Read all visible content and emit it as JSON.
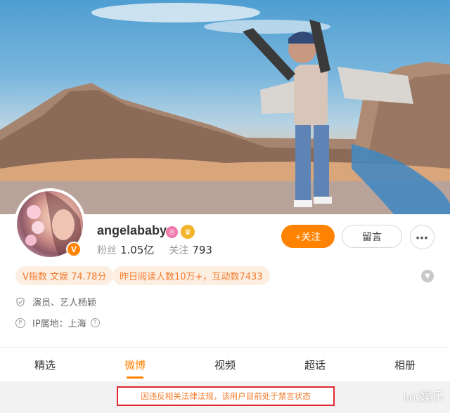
{
  "profile": {
    "name": "angelababy",
    "verified_mark": "V",
    "fans_label": "粉丝",
    "fans_count": "1.05亿",
    "following_label": "关注",
    "following_count": "793"
  },
  "actions": {
    "follow_label": "+关注",
    "message_label": "留言",
    "more_label": "•••"
  },
  "tags": [
    "V指数 文娱 74.78分",
    "昨日阅读人数10万+，互动数7433"
  ],
  "info": {
    "occupation": "演员、艺人杨颖",
    "ip_location": "IP属地：上海"
  },
  "tabs": [
    {
      "label": "精选",
      "active": false
    },
    {
      "label": "微博",
      "active": true
    },
    {
      "label": "视频",
      "active": false
    },
    {
      "label": "超话",
      "active": false
    },
    {
      "label": "相册",
      "active": false
    }
  ],
  "notice": "因违反相关法律法规，该用户目前处于禁言状态",
  "watermark": "hot娱乐",
  "colors": {
    "accent": "#ff8200",
    "notice_border": "#e0282e",
    "tag_bg": "#fdeee2"
  },
  "icons": [
    "shield-icon",
    "ip-location-icon",
    "help-icon",
    "chevron-down-icon",
    "vip-badge-icon",
    "crown-badge-icon"
  ]
}
